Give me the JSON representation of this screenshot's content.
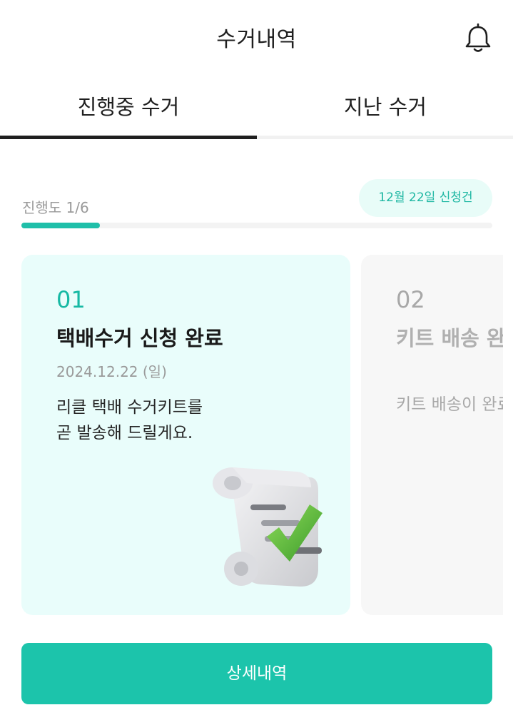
{
  "header": {
    "title": "수거내역",
    "bell_icon": "bell-icon"
  },
  "tabs": [
    {
      "label": "진행중 수거",
      "active": true
    },
    {
      "label": "지난 수거",
      "active": false
    }
  ],
  "progress": {
    "label": "진행도 1/6",
    "fraction": 0.1667,
    "date_pill": "12월 22일 신청건"
  },
  "cards": [
    {
      "number": "01",
      "title": "택배수거 신청 완료",
      "date": "2024.12.22 (일)",
      "description": "리클 택배 수거키트를\n곧 발송해 드릴게요.",
      "illustration": "receipt-check-icon"
    },
    {
      "number": "02",
      "title": "키트 배송 완",
      "description": "키트 배송이 완료"
    }
  ],
  "detail_button": {
    "label": "상세내역"
  },
  "colors": {
    "accent": "#1cc4ab",
    "card_active_bg": "#e9fdfb",
    "card_inactive_bg": "#f7f7f7"
  }
}
